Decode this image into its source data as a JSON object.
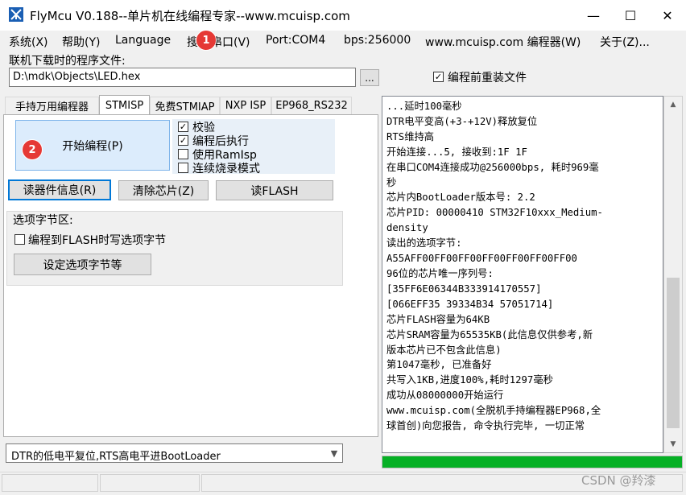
{
  "window": {
    "title": "FlyMcu V0.188--单片机在线编程专家--www.mcuisp.com"
  },
  "winbuttons": {
    "minimize": "—",
    "maximize": "☐",
    "close": "✕"
  },
  "menu": [
    "系统(X)",
    "帮助(Y)",
    "Language",
    "搜",
    "串口(V)",
    "Port:COM4",
    "bps:256000",
    "www.mcuisp.com 编程器(W)",
    "关于(Z)..."
  ],
  "badges": {
    "one": "1",
    "two": "2"
  },
  "file": {
    "label": "联机下载时的程序文件:",
    "path": "D:\\mdk\\Objects\\LED.hex",
    "browse": "...",
    "reload_label": "编程前重装文件",
    "reload_checked": true
  },
  "tabs": [
    "手持万用编程器",
    "STMISP",
    "免费STMIAP",
    "NXP ISP",
    "EP968_RS232"
  ],
  "actions": {
    "start": "开始编程(P)",
    "read_info": "读器件信息(R)",
    "erase": "清除芯片(Z)",
    "read_flash": "读FLASH"
  },
  "options": [
    {
      "label": "校验",
      "checked": true
    },
    {
      "label": "编程后执行",
      "checked": true
    },
    {
      "label": "使用RamIsp",
      "checked": false
    },
    {
      "label": "连续烧录模式",
      "checked": false
    }
  ],
  "option_bytes": {
    "group_label": "选项字节区:",
    "write_label": "编程到FLASH时写选项字节",
    "write_checked": false,
    "set_button": "设定选项字节等"
  },
  "mode_select": {
    "value": "DTR的低电平复位,RTS高电平进BootLoader"
  },
  "log": [
    "...延时100毫秒",
    "DTR电平变高(+3-+12V)释放复位",
    "RTS维持高",
    "开始连接...5, 接收到:1F 1F",
    "在串口COM4连接成功@256000bps, 耗时969毫",
    "秒",
    "芯片内BootLoader版本号: 2.2",
    "芯片PID: 00000410  STM32F10xxx_Medium-",
    "density",
    "读出的选项字节:",
    "A55AFF00FF00FF00FF00FF00FF00FF00",
    "96位的芯片唯一序列号:",
    "[35FF6E06344B333914170557]",
    "[066EFF35 39334B34 57051714]",
    "芯片FLASH容量为64KB",
    "芯片SRAM容量为65535KB(此信息仅供参考,新",
    "版本芯片已不包含此信息)",
    "第1047毫秒, 已准备好",
    "共写入1KB,进度100%,耗时1297毫秒",
    "成功从08000000开始运行",
    "www.mcuisp.com(全脱机手持编程器EP968,全",
    "球首创)向您报告, 命令执行完毕, 一切正常"
  ],
  "progress": {
    "percent": 100,
    "color": "#06b025"
  },
  "watermark": "CSDN @羚漆"
}
